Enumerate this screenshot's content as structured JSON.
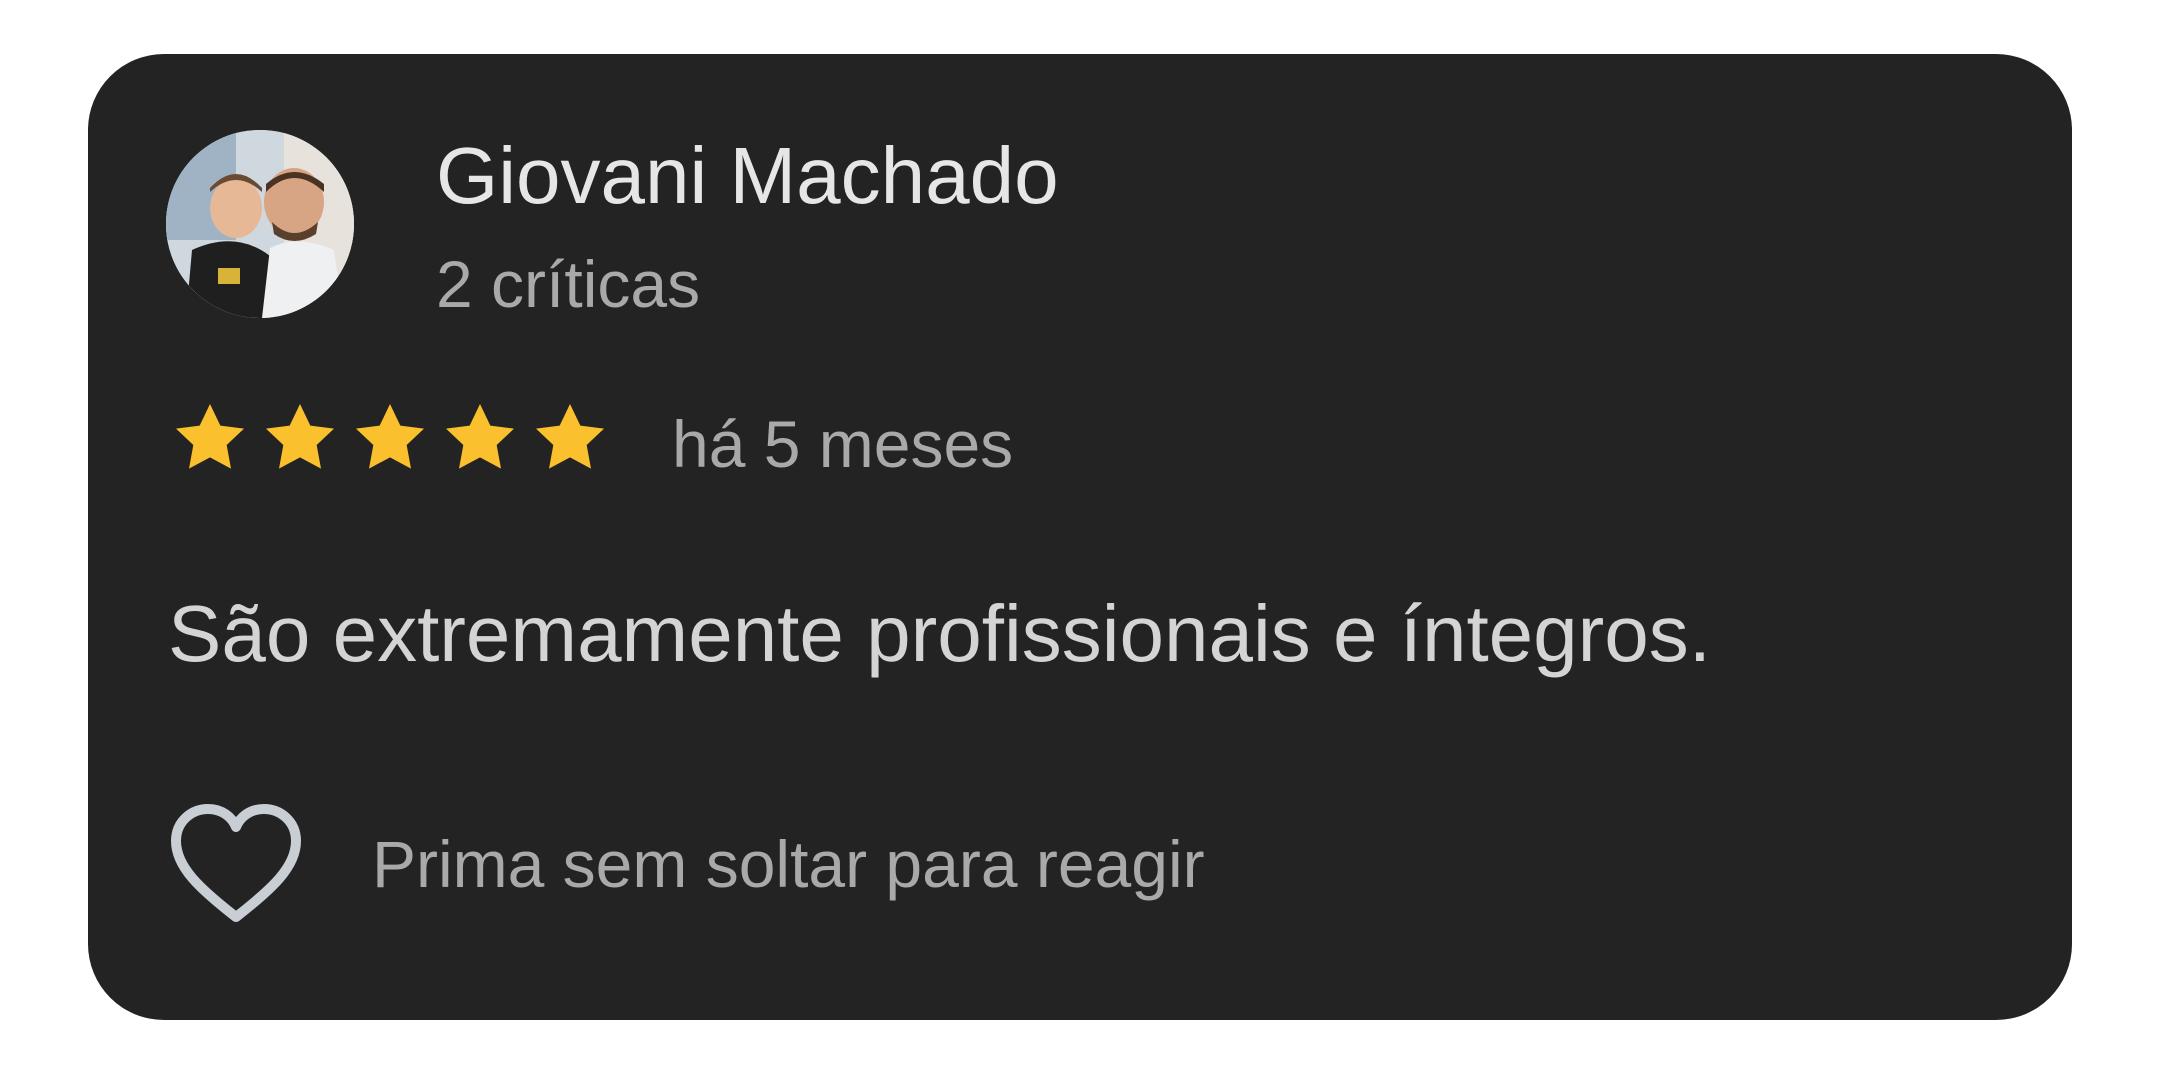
{
  "review": {
    "author_name": "Giovani Machado",
    "review_count": "2 críticas",
    "rating": 5,
    "rating_max": 5,
    "date": "há 5 meses",
    "text": "São extremamente profissionais e íntegros.",
    "reaction_label": "Prima sem soltar para reagir"
  },
  "icons": {
    "avatar": "user-avatar-photo",
    "star": "star-icon",
    "heart": "heart-outline-icon"
  },
  "colors": {
    "card_background": "#232323",
    "page_background": "#ffffff",
    "star_fill": "#fbc02d",
    "primary_text": "#e6e6e6",
    "secondary_text": "#a9a9a9",
    "heart_stroke": "#c9cdd4"
  }
}
